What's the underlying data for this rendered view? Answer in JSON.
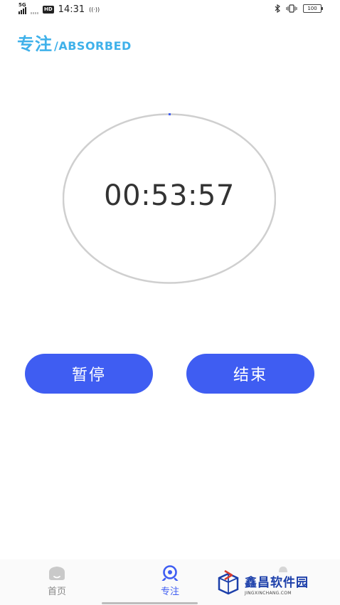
{
  "status_bar": {
    "network": "5G",
    "hd": "HD",
    "time": "14:31",
    "hotspot": "((·))",
    "battery": "100"
  },
  "header": {
    "title_zh": "专注",
    "title_en": "/ABSORBED",
    "color": "#3fb1ea"
  },
  "timer": {
    "display": "00:53:57"
  },
  "actions": {
    "pause_label": "暂停",
    "end_label": "结束",
    "color": "#3f5df2"
  },
  "bottom_nav": {
    "items": [
      {
        "label": "首页",
        "icon": "home-icon",
        "active": false
      },
      {
        "label": "专注",
        "icon": "focus-icon",
        "active": true
      }
    ]
  },
  "watermark": {
    "main": "鑫昌软件园",
    "sub": "JINGXINCHANG.COM"
  }
}
